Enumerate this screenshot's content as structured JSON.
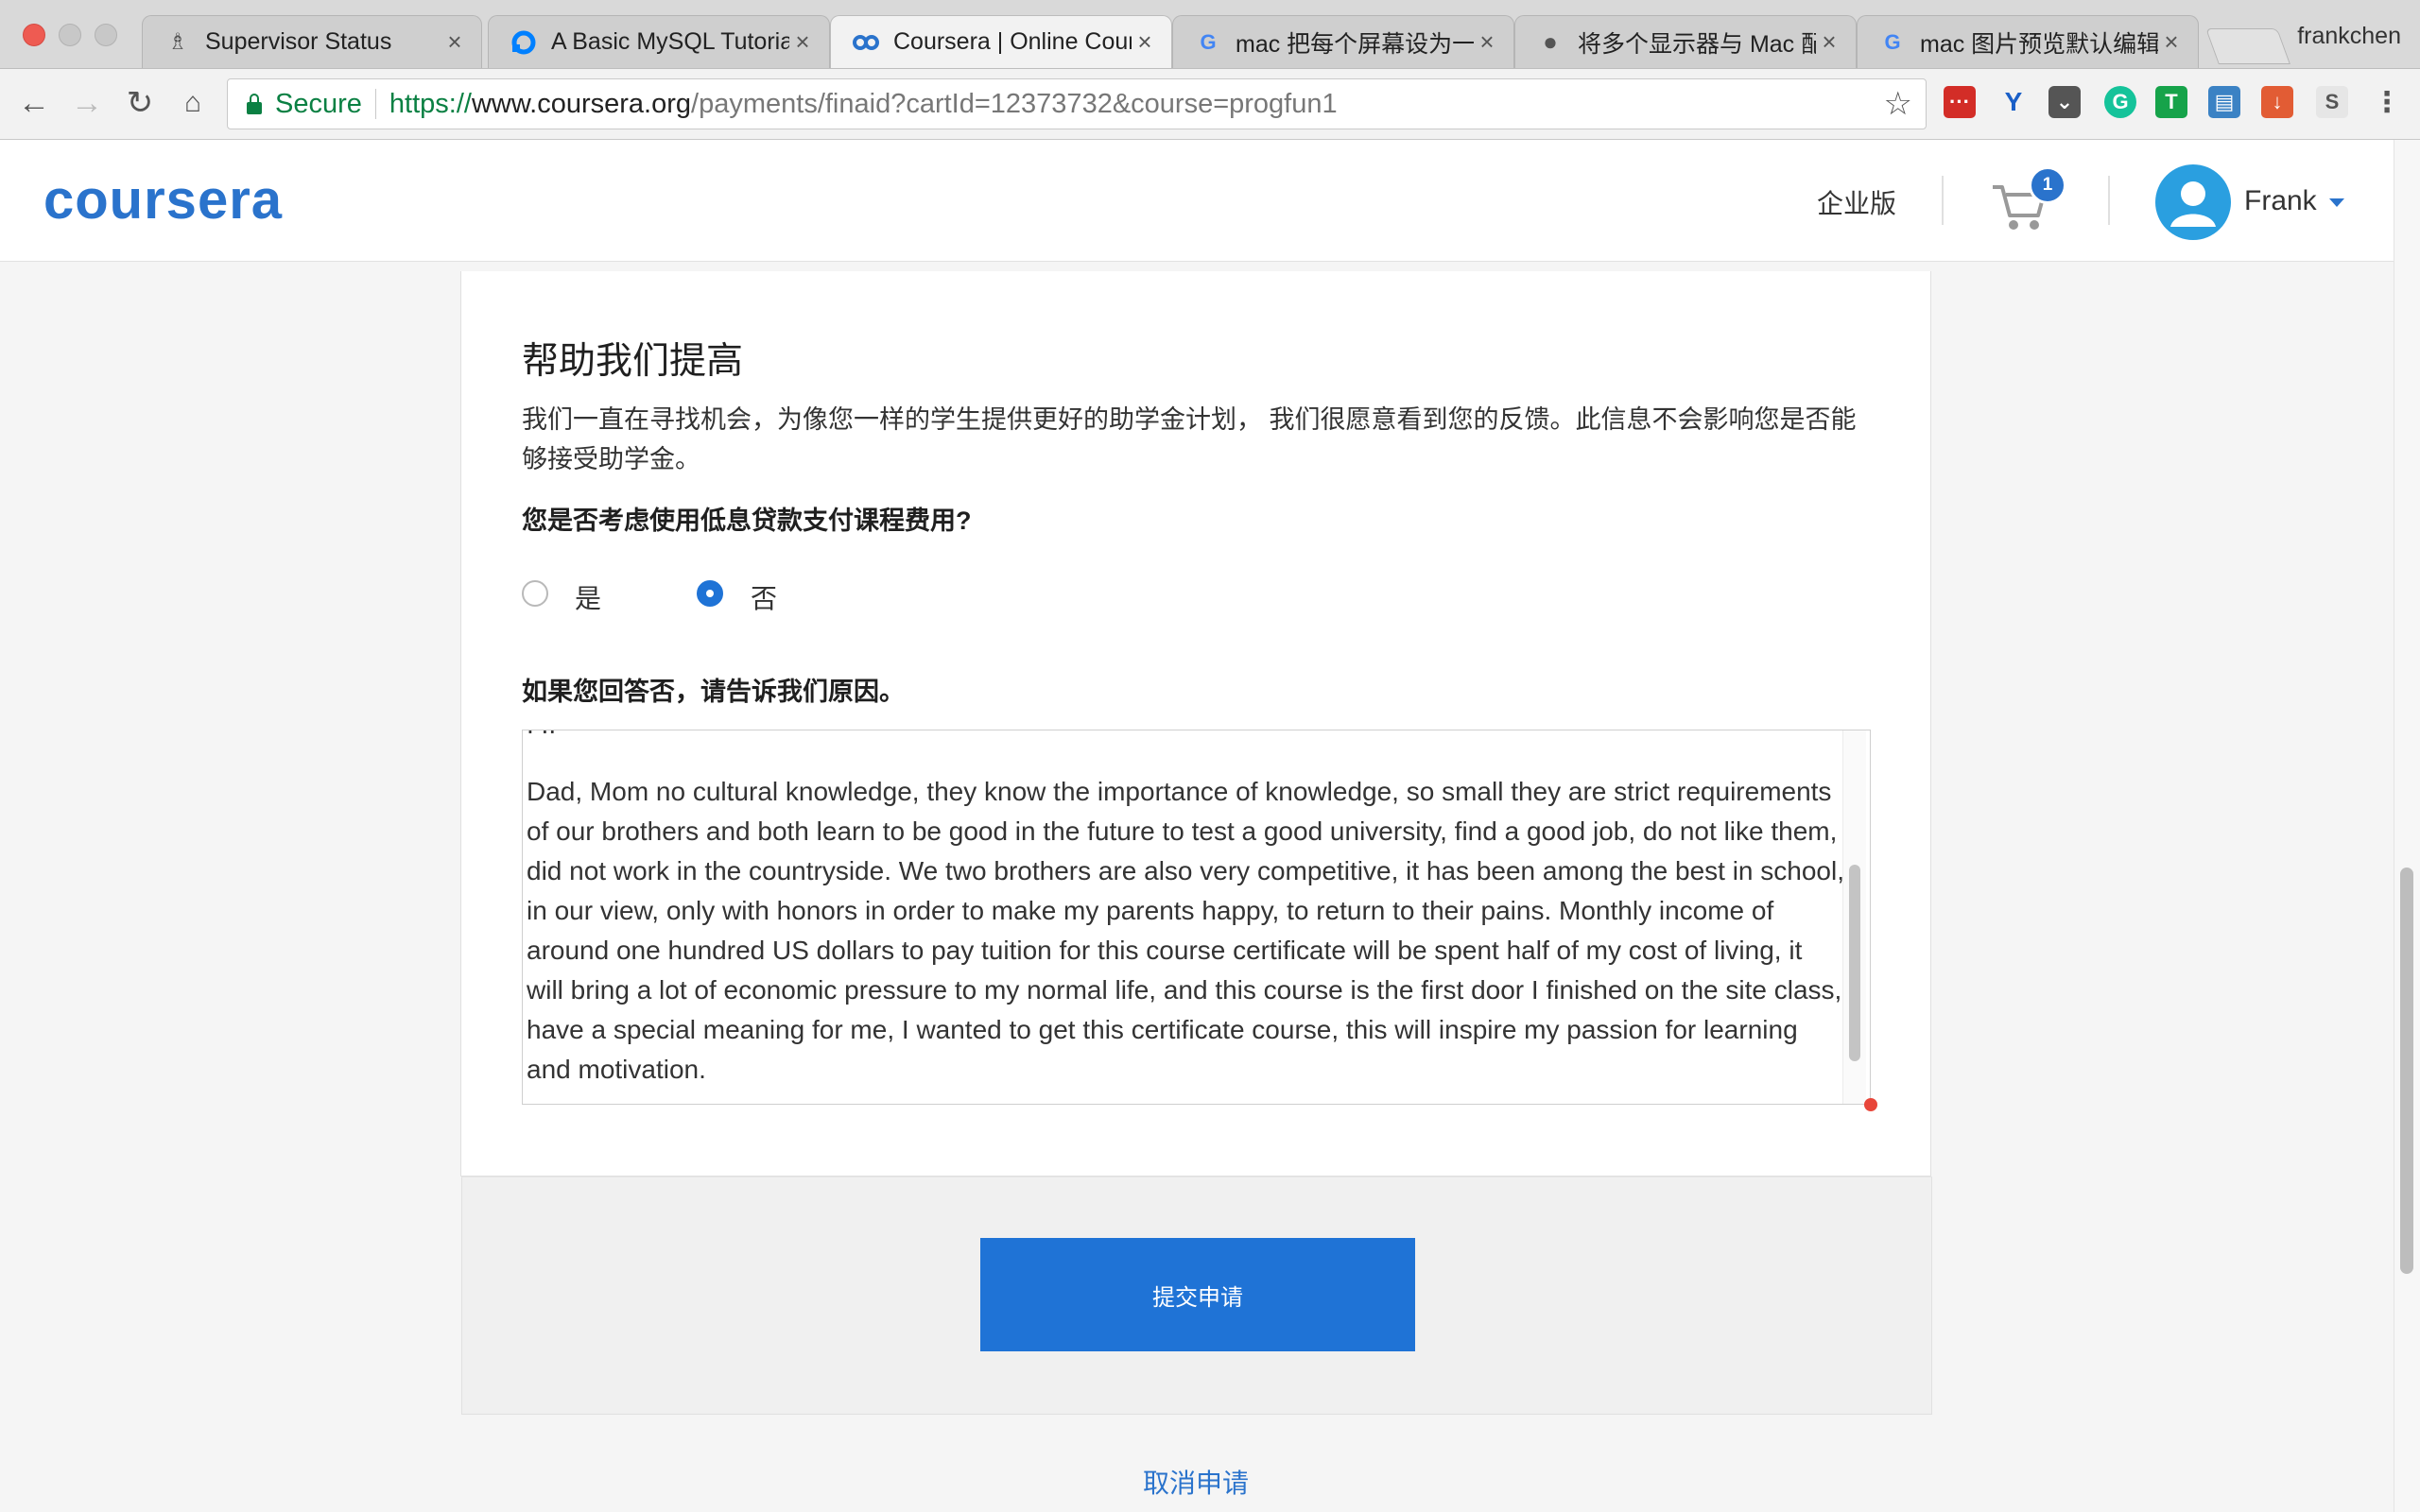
{
  "browser": {
    "profile_name": "frankchen",
    "tabs": [
      {
        "title": "Supervisor Status",
        "favicon": "supervisor-icon"
      },
      {
        "title": "A Basic MySQL Tutorial",
        "favicon": "digitalocean-icon"
      },
      {
        "title": "Coursera | Online Courses",
        "favicon": "coursera-icon",
        "active": true
      },
      {
        "title": "mac 把每个屏幕设为一个空间",
        "favicon": "google-icon"
      },
      {
        "title": "将多个显示器与 Mac 配合使用",
        "favicon": "apple-icon"
      },
      {
        "title": "mac 图片预览默认编辑",
        "favicon": "google-icon"
      }
    ],
    "secure_label": "Secure",
    "url_scheme": "https://",
    "url_host": "www.coursera.org",
    "url_path": "/payments/finaid?cartId=12373732&course=progfun1"
  },
  "header": {
    "logo": "coursera",
    "enterprise_label": "企业版",
    "cart_count": "1",
    "user_name": "Frank"
  },
  "form": {
    "heading": "帮助我们提高",
    "intro": "我们一直在寻找机会，为像您一样的学生提供更好的助学金计划， 我们很愿意看到您的反馈。此信息不会影响您是否能够接受助学金。",
    "question_loan": "您是否考虑使用低息贷款支付课程费用?",
    "option_yes": "是",
    "option_no": "否",
    "selected": "no",
    "question_reason": "如果您回答否，请告诉我们原因。",
    "reason_text": "Dad, Mom no cultural knowledge, they know the importance of knowledge, so small they are strict requirements of our brothers and both learn to be good in the future to test a good university, find a good job, do not like them, did not work in the countryside. We two brothers are also very competitive, it has been among the best in school, in our view, only with honors in order to make my parents happy, to return to their pains. Monthly income of around one hundred US dollars to pay tuition for this course certificate will be spent half of my cost of living, it will bring a lot of economic pressure to my normal life, and this course is the first door I finished on the site class, have a special meaning for me, I wanted to get this certificate course, this will inspire my passion for learning and motivation.",
    "submit_label": "提交申请",
    "cancel_label": "取消申请"
  },
  "colors": {
    "brand": "#2a73cc",
    "button": "#1f73d6",
    "secure": "#0b8043"
  }
}
